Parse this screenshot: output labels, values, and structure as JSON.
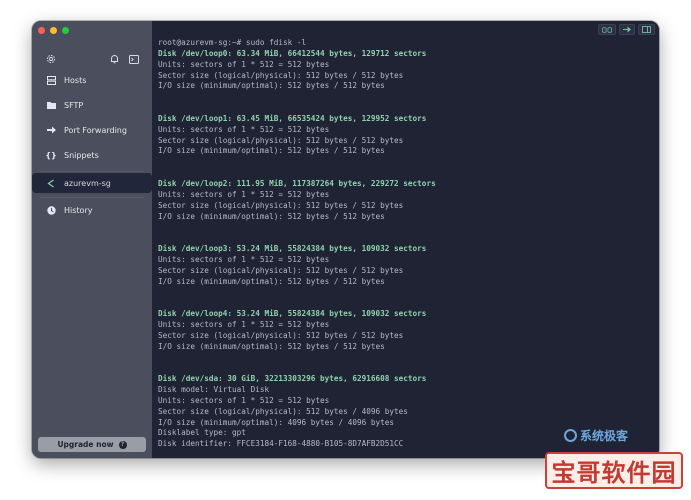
{
  "sidebar": {
    "nav": [
      {
        "label": "Hosts",
        "icon": "hosts-icon"
      },
      {
        "label": "SFTP",
        "icon": "folder-icon"
      },
      {
        "label": "Port Forwarding",
        "icon": "arrow-right-icon"
      },
      {
        "label": "Snippets",
        "icon": "braces-icon"
      }
    ],
    "session": {
      "label": "azurevm-sg",
      "icon": "session-chevron-icon"
    },
    "history": {
      "label": "History",
      "icon": "clock-icon"
    },
    "upgrade_label": "Upgrade now"
  },
  "terminal": {
    "lines": [
      {
        "text": "root@azurevm-sg:~# sudo fdisk -l",
        "style": "normal"
      },
      {
        "text": "Disk /dev/loop0: 63.34 MiB, 66412544 bytes, 129712 sectors",
        "style": "bold"
      },
      {
        "text": "Units: sectors of 1 * 512 = 512 bytes",
        "style": "normal"
      },
      {
        "text": "Sector size (logical/physical): 512 bytes / 512 bytes",
        "style": "normal"
      },
      {
        "text": "I/O size (minimum/optimal): 512 bytes / 512 bytes",
        "style": "normal"
      },
      {
        "text": "",
        "style": "normal"
      },
      {
        "text": "",
        "style": "normal"
      },
      {
        "text": "Disk /dev/loop1: 63.45 MiB, 66535424 bytes, 129952 sectors",
        "style": "bold"
      },
      {
        "text": "Units: sectors of 1 * 512 = 512 bytes",
        "style": "normal"
      },
      {
        "text": "Sector size (logical/physical): 512 bytes / 512 bytes",
        "style": "normal"
      },
      {
        "text": "I/O size (minimum/optimal): 512 bytes / 512 bytes",
        "style": "normal"
      },
      {
        "text": "",
        "style": "normal"
      },
      {
        "text": "",
        "style": "normal"
      },
      {
        "text": "Disk /dev/loop2: 111.95 MiB, 117387264 bytes, 229272 sectors",
        "style": "bold"
      },
      {
        "text": "Units: sectors of 1 * 512 = 512 bytes",
        "style": "normal"
      },
      {
        "text": "Sector size (logical/physical): 512 bytes / 512 bytes",
        "style": "normal"
      },
      {
        "text": "I/O size (minimum/optimal): 512 bytes / 512 bytes",
        "style": "normal"
      },
      {
        "text": "",
        "style": "normal"
      },
      {
        "text": "",
        "style": "normal"
      },
      {
        "text": "Disk /dev/loop3: 53.24 MiB, 55824384 bytes, 109032 sectors",
        "style": "bold"
      },
      {
        "text": "Units: sectors of 1 * 512 = 512 bytes",
        "style": "normal"
      },
      {
        "text": "Sector size (logical/physical): 512 bytes / 512 bytes",
        "style": "normal"
      },
      {
        "text": "I/O size (minimum/optimal): 512 bytes / 512 bytes",
        "style": "normal"
      },
      {
        "text": "",
        "style": "normal"
      },
      {
        "text": "",
        "style": "normal"
      },
      {
        "text": "Disk /dev/loop4: 53.24 MiB, 55824384 bytes, 109032 sectors",
        "style": "bold"
      },
      {
        "text": "Units: sectors of 1 * 512 = 512 bytes",
        "style": "normal"
      },
      {
        "text": "Sector size (logical/physical): 512 bytes / 512 bytes",
        "style": "normal"
      },
      {
        "text": "I/O size (minimum/optimal): 512 bytes / 512 bytes",
        "style": "normal"
      },
      {
        "text": "",
        "style": "normal"
      },
      {
        "text": "",
        "style": "normal"
      },
      {
        "text": "Disk /dev/sda: 30 GiB, 32213303296 bytes, 62916608 sectors",
        "style": "bold"
      },
      {
        "text": "Disk model: Virtual Disk",
        "style": "normal"
      },
      {
        "text": "Units: sectors of 1 * 512 = 512 bytes",
        "style": "normal"
      },
      {
        "text": "Sector size (logical/physical): 512 bytes / 4096 bytes",
        "style": "normal"
      },
      {
        "text": "I/O size (minimum/optimal): 4096 bytes / 4096 bytes",
        "style": "normal"
      },
      {
        "text": "Disklabel type: gpt",
        "style": "normal"
      },
      {
        "text": "Disk identifier: FFCE3184-F168-4880-B105-8D7AFB2D51CC",
        "style": "normal"
      }
    ]
  },
  "watermarks": {
    "small": "系统极客",
    "large": "宝哥软件园"
  },
  "colors": {
    "sidebar_bg": "#4b4e5c",
    "terminal_bg": "#1f2333",
    "terminal_text": "#b5b9c8",
    "terminal_highlight": "#8fd3ae",
    "upgrade_bg": "#9a9ca6"
  }
}
